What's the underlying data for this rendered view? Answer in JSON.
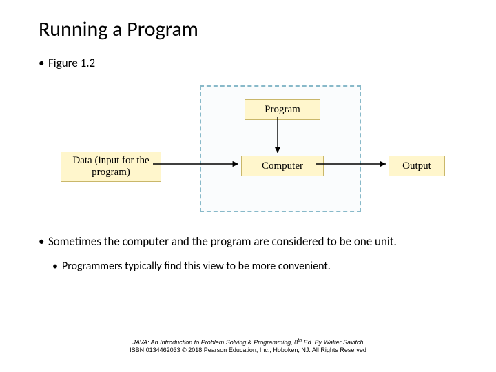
{
  "title": "Running a Program",
  "bullets": {
    "figure_label": "Figure 1.2",
    "main": "Sometimes the computer and the program are considered to be one unit.",
    "sub": "Programmers typically find this view to be more convenient."
  },
  "figure": {
    "nodes": {
      "data": "Data (input for the program)",
      "program": "Program",
      "computer": "Computer",
      "output": "Output"
    }
  },
  "footer": {
    "line1_prefix": "JAVA: An Introduction to Problem Solving & Programming, 8",
    "line1_sup": "th",
    "line1_suffix": " Ed. By Walter Savitch",
    "line2": "ISBN 0134462033  © 2018 Pearson Education, Inc., Hoboken, NJ. All Rights Reserved"
  }
}
